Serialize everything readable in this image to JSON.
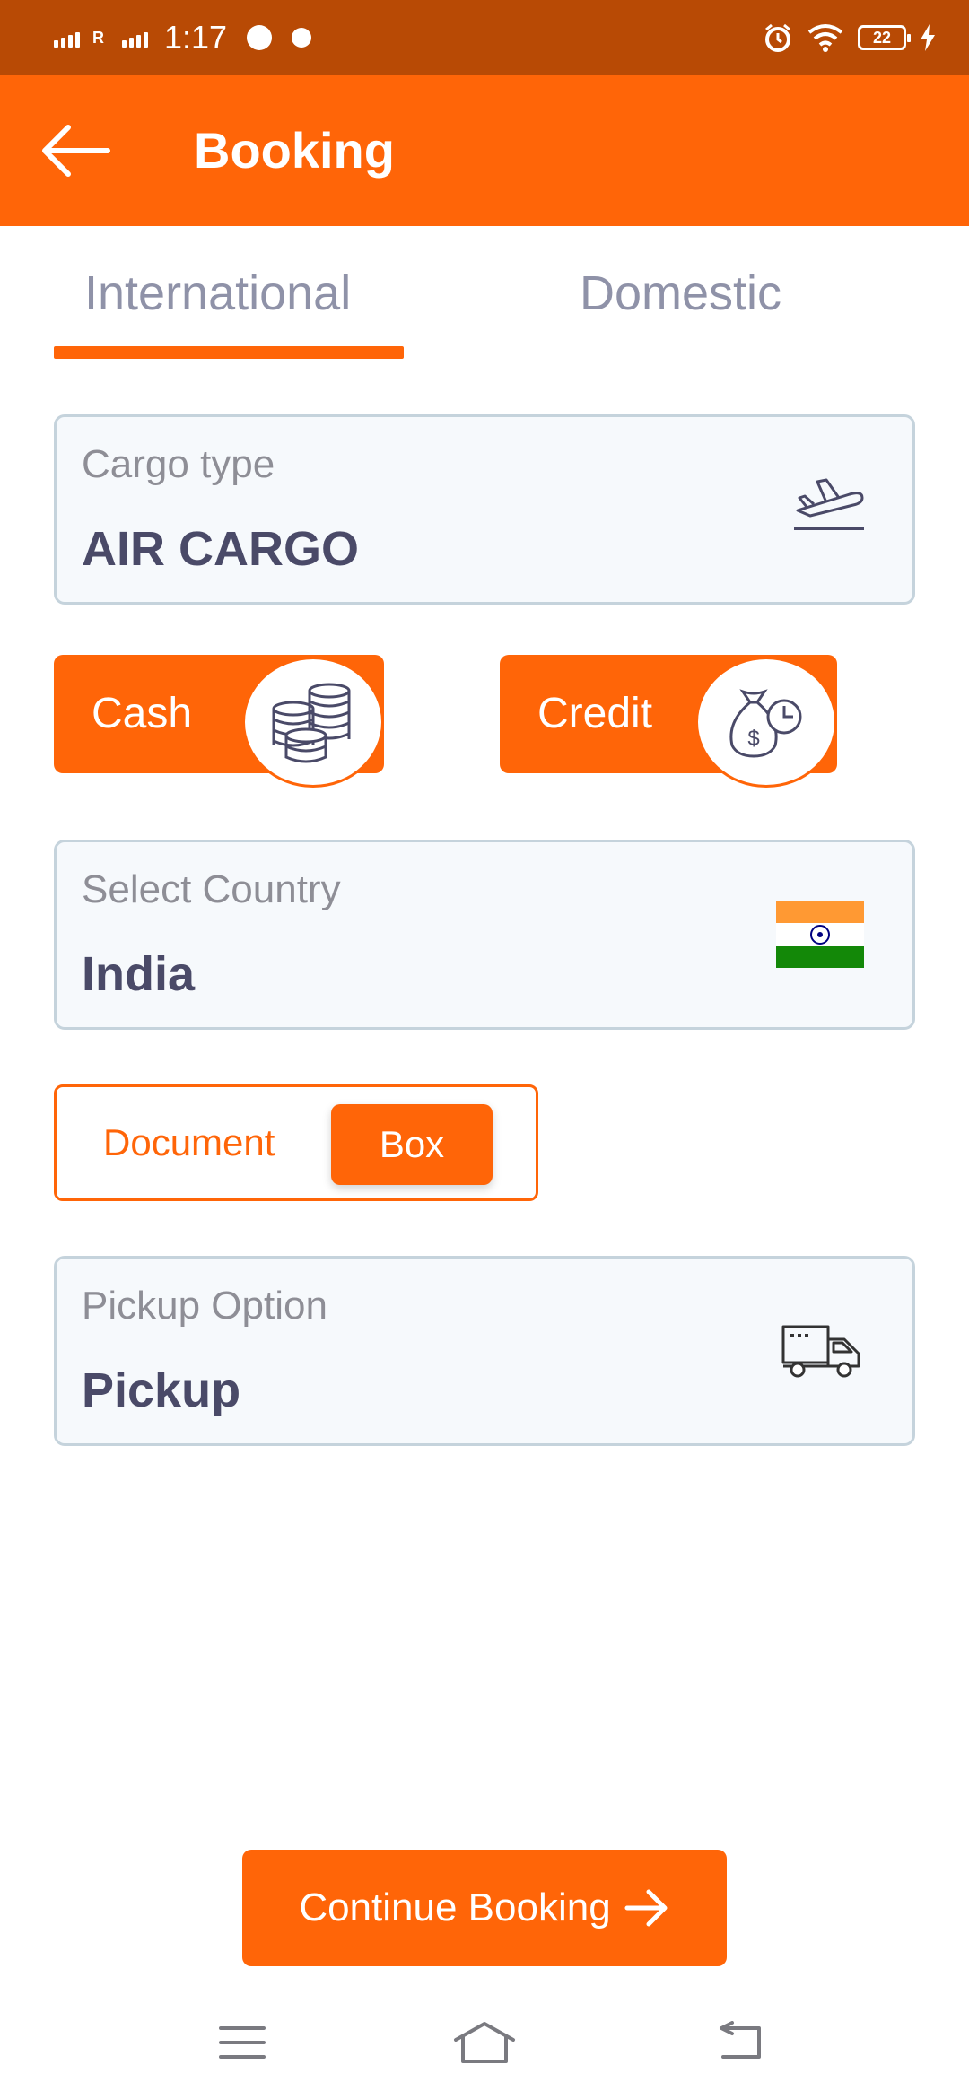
{
  "status_bar": {
    "signal1_label": "R",
    "time": "1:17",
    "battery_level": "22"
  },
  "app_bar": {
    "title": "Booking",
    "back_icon": "arrow-left-icon"
  },
  "tabs": [
    {
      "label": "International",
      "selected": true
    },
    {
      "label": "Domestic",
      "selected": false
    }
  ],
  "cargo": {
    "label": "Cargo type",
    "value": "AIR CARGO",
    "icon": "plane-takeoff-icon"
  },
  "payment": {
    "cash_label": "Cash",
    "cash_icon": "coins-stack-icon",
    "credit_label": "Credit",
    "credit_icon": "money-bag-clock-icon"
  },
  "country": {
    "label": "Select Country",
    "value": "India",
    "icon": "india-flag-icon"
  },
  "shipment_type": {
    "document_label": "Document",
    "box_label": "Box",
    "selected": "Box"
  },
  "pickup": {
    "label": "Pickup Option",
    "value": "Pickup",
    "icon": "truck-icon"
  },
  "continue_button": {
    "label": "Continue Booking",
    "icon": "arrow-right-icon"
  },
  "colors": {
    "primary": "#FF6508",
    "status_bar": "#B84A05",
    "field_bg": "#F6F9FC",
    "field_border": "#C5D3DC",
    "value_text": "#4A4A68",
    "label_text": "#8E8E96"
  }
}
